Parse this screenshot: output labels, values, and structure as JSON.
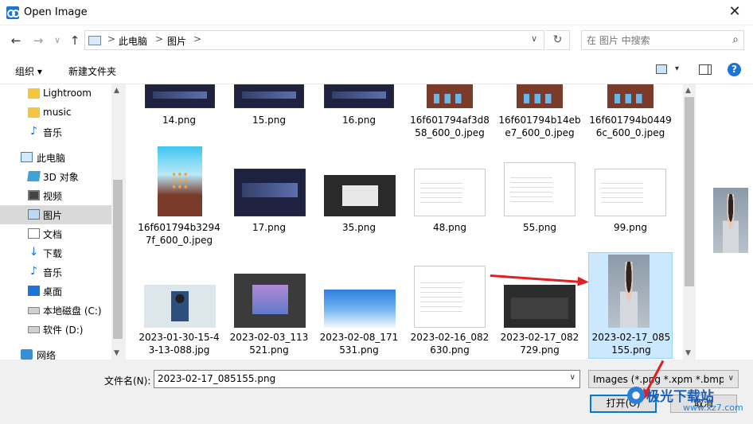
{
  "window": {
    "title": "Open Image",
    "close_glyph": "✕"
  },
  "nav": {
    "back": "←",
    "forward": "→",
    "dropdown": "∨",
    "up": "↑"
  },
  "address": {
    "crumbs": [
      "此电脑",
      "图片"
    ],
    "separator": ">",
    "dropdown": "∨",
    "refresh": "↻"
  },
  "search": {
    "placeholder": "在 图片 中搜索",
    "icon": "⌕"
  },
  "toolbar": {
    "organize": "组织 ▾",
    "new_folder": "新建文件夹",
    "view_dropdown": "▾",
    "help": "?"
  },
  "sidebar": {
    "items": [
      {
        "label": "Lightroom",
        "icon": "folder-icon"
      },
      {
        "label": "music",
        "icon": "folder-icon"
      },
      {
        "label": "音乐",
        "icon": "music-icon",
        "glyph": "♪"
      },
      {
        "label": "此电脑",
        "icon": "pc-icon"
      },
      {
        "label": "3D 对象",
        "icon": "3d-objects-icon"
      },
      {
        "label": "视频",
        "icon": "video-icon"
      },
      {
        "label": "图片",
        "icon": "pictures-icon",
        "selected": true
      },
      {
        "label": "文档",
        "icon": "documents-icon"
      },
      {
        "label": "下载",
        "icon": "download-icon",
        "glyph": "↓"
      },
      {
        "label": "音乐",
        "icon": "music-icon",
        "glyph": "♪"
      },
      {
        "label": "桌面",
        "icon": "desktop-icon"
      },
      {
        "label": "本地磁盘 (C:)",
        "icon": "disk-icon"
      },
      {
        "label": "软件 (D:)",
        "icon": "disk-icon"
      },
      {
        "label": "网络",
        "icon": "network-icon"
      }
    ],
    "scroll_up": "▲",
    "scroll_down": "▼"
  },
  "files": [
    {
      "name": "14.png",
      "thumb": "dark-ui"
    },
    {
      "name": "15.png",
      "thumb": "dark-ui"
    },
    {
      "name": "16.png",
      "thumb": "dark-ui"
    },
    {
      "name": "16f601794af3d858_600_0.jpeg",
      "thumb": "game"
    },
    {
      "name": "16f601794b14ebe7_600_0.jpeg",
      "thumb": "game"
    },
    {
      "name": "16f601794b04496c_600_0.jpeg",
      "thumb": "game"
    },
    {
      "name": "16f601794b32947f_600_0.jpeg",
      "thumb": "game-tall"
    },
    {
      "name": "17.png",
      "thumb": "dark-ui"
    },
    {
      "name": "35.png",
      "thumb": "photoshop"
    },
    {
      "name": "48.png",
      "thumb": "doc-ui"
    },
    {
      "name": "55.png",
      "thumb": "doc-ui"
    },
    {
      "name": "99.png",
      "thumb": "doc-ui"
    },
    {
      "name": "2023-01-30-15-43-13-088.jpg",
      "thumb": "video"
    },
    {
      "name": "2023-02-03_113521.png",
      "thumb": "photoshop-purple"
    },
    {
      "name": "2023-02-08_171531.png",
      "thumb": "sky"
    },
    {
      "name": "2023-02-16_082630.png",
      "thumb": "doc-ui"
    },
    {
      "name": "2023-02-17_082729.png",
      "thumb": "photoshop-dark"
    },
    {
      "name": "2023-02-17_085155.png",
      "thumb": "person",
      "selected": true
    }
  ],
  "file_scroll": {
    "up": "▲",
    "down": "▼"
  },
  "bottom": {
    "filename_label": "文件名(N):",
    "filename_value": "2023-02-17_085155.png",
    "filename_dropdown": "∨",
    "filetype": "Images (*.png *.xpm *.bmp *",
    "filetype_dropdown": "∨",
    "open_label": "打开(O)",
    "cancel_label": "取消"
  },
  "watermark": {
    "title": "极光下载站",
    "url": "www.xz7.com"
  },
  "colors": {
    "accent": "#0078d7",
    "annotation_arrow": "#e02020",
    "selection": "#cce8ff"
  }
}
